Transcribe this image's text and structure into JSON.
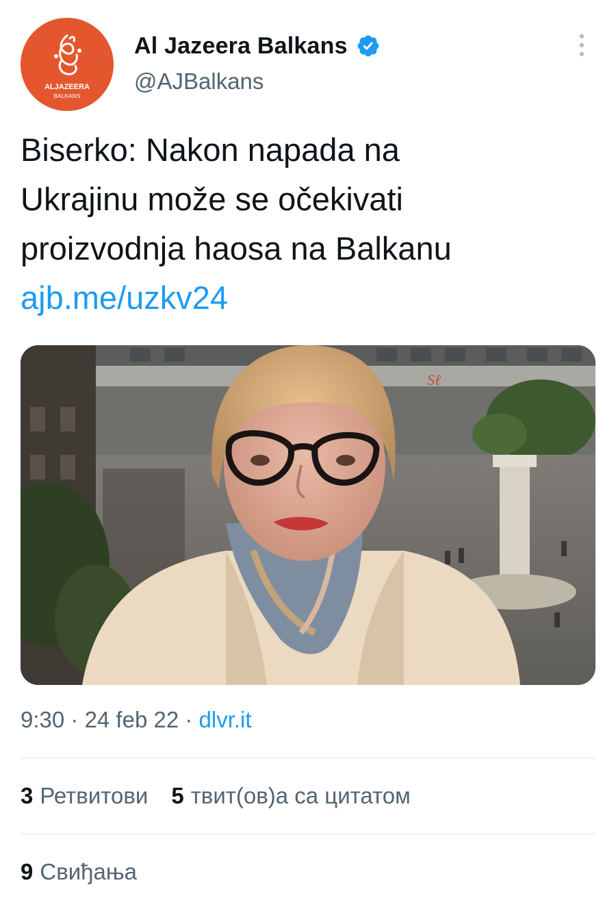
{
  "account": {
    "display_name": "Al Jazeera Balkans",
    "handle": "@AJBalkans",
    "avatar_logo_text": [
      "ALJAZEERA",
      "BALKANS"
    ],
    "avatar_color": "#e4572e",
    "verified_icon": "verified-badge-icon",
    "more_icon": "more-vertical-icon"
  },
  "tweet": {
    "text_lines": [
      "Biserko: Nakon napada na",
      "Ukrajinu može se očekivati",
      "proizvodnja haosa na Balkanu"
    ],
    "link": "ajb.me/uzkv24",
    "media": "photo-woman-with-glasses-city-street-background"
  },
  "meta": {
    "time": "9:30",
    "separator": " · ",
    "date": "24 feb 22",
    "source": "dlvr.it"
  },
  "stats": {
    "retweets_count": "3",
    "retweets_label": "Ретвитови",
    "quotes_count": "5",
    "quotes_label": "твит(ов)а са цитатом",
    "likes_count": "9",
    "likes_label": "Свиђања"
  },
  "colors": {
    "link": "#1d9bf0",
    "secondary_text": "#536471",
    "primary_text": "#0f1419",
    "divider": "#e1e6ea"
  }
}
